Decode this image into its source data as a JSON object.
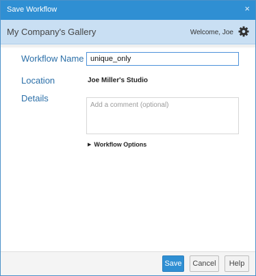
{
  "dialog": {
    "title": "Save Workflow",
    "close_glyph": "×"
  },
  "header": {
    "gallery_name": "My Company's Gallery",
    "welcome_text": "Welcome, Joe",
    "settings_icon": "gear-icon"
  },
  "form": {
    "name_label": "Workflow Name",
    "name_value": "unique_only",
    "location_label": "Location",
    "location_value": "Joe Miller's Studio",
    "details_label": "Details",
    "details_placeholder": "Add a comment (optional)",
    "options_label": "Workflow Options",
    "options_icon": "triangle-right-icon"
  },
  "footer": {
    "save_label": "Save",
    "cancel_label": "Cancel",
    "help_label": "Help"
  },
  "colors": {
    "title_bar": "#2f8fd3",
    "header_band": "#c9dff3",
    "label_text": "#2b6fa8",
    "primary_button": "#2f8fd3"
  }
}
